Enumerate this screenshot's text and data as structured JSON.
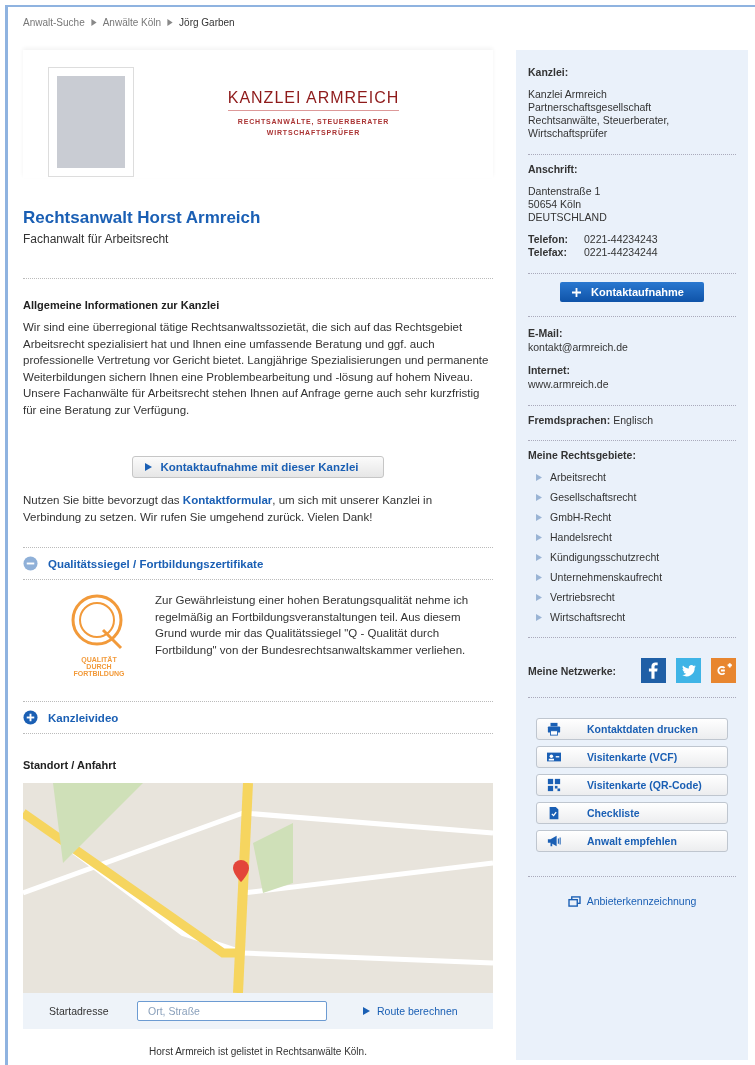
{
  "breadcrumb": [
    {
      "label": "Anwalt-Suche",
      "current": false
    },
    {
      "label": "Anwälte Köln",
      "current": false
    },
    {
      "label": "Jörg Garben",
      "current": true
    }
  ],
  "header": {
    "logo_title": "KANZLEI ARMREICH",
    "logo_line1": "RECHTSANWÄLTE, STEUERBERATER",
    "logo_line2": "WIRTSCHAFTSPRÜFER",
    "name": "Rechtsanwalt Horst Armreich",
    "subtitle": "Fachanwalt für Arbeitsrecht"
  },
  "info": {
    "heading": "Allgemeine Informationen zur Kanzlei",
    "text": "Wir sind eine überregional tätige Rechtsanwaltssozietät, die sich auf das Rechtsgebiet Arbeitsrecht spezialisiert hat und Ihnen eine umfassende Beratung und ggf. auch professionelle Vertretung vor Gericht bietet. Langjährige Spezialisierungen und permanente Weiterbildungen sichern Ihnen eine Problembearbeitung und -lösung auf hohem Niveau. Unsere Fachanwälte für Arbeitsrecht stehen Ihnen auf Anfrage gerne auch sehr kurzfristig für eine Beratung zur Verfügung."
  },
  "contact_button": "Kontaktaufnahme mit dieser Kanzlei",
  "contact_note": {
    "before": "Nutzen Sie bitte bevorzugt das ",
    "link": "Kontaktformular",
    "after": ", um sich mit unserer Kanzlei in Verbindung zu setzen. Wir rufen Sie umgehend zurück. Vielen Dank!"
  },
  "sections": [
    {
      "title": "Qualitätssiegel / Fortbildungszertifikate",
      "expanded": true,
      "badge_text": "QUALITÄT DURCH FORTBILDUNG",
      "text": "Zur Gewährleistung einer hohen Beratungsqualität nehme ich regelmäßig an Fortbildungsveranstaltungen teil. Aus diesem Grund wurde mir das Qualitätssiegel \"Q - Qualität durch Fortbildung\" von der Bundesrechtsanwaltskammer verliehen."
    },
    {
      "title": "Kanzleivideo",
      "expanded": false
    }
  ],
  "location": {
    "heading": "Standort / Anfahrt",
    "start_label": "Startadresse",
    "start_placeholder": "Ort, Straße",
    "route_link": "Route berechnen",
    "footer": "Horst Armreich ist gelistet in Rechtsanwälte Köln."
  },
  "sidebar": {
    "firm_label": "Kanzlei:",
    "firm_lines": [
      "Kanzlei Armreich",
      "Partnerschaftsgesellschaft",
      "Rechtsanwälte, Steuerberater,",
      "Wirtschaftsprüfer"
    ],
    "address_label": "Anschrift:",
    "address_lines": [
      "Dantenstraße 1",
      "50654 Köln",
      "DEUTSCHLAND"
    ],
    "phones": [
      {
        "label": "Telefon:",
        "value": "0221-44234243"
      },
      {
        "label": "Telefax:",
        "value": "0221-44234244"
      }
    ],
    "contact_button": "Kontaktaufnahme",
    "email_label": "E-Mail:",
    "email": "kontakt@armreich.de",
    "internet_label": "Internet:",
    "internet": "www.armreich.de",
    "languages_label": "Fremdsprachen:",
    "languages": "Englisch",
    "areas_label": "Meine Rechtsgebiete:",
    "areas": [
      "Arbeitsrecht",
      "Gesellschaftsrecht",
      "GmbH-Recht",
      "Handelsrecht",
      "Kündigungsschutzrecht",
      "Unternehmenskaufrecht",
      "Vertriebsrecht",
      "Wirtschaftsrecht"
    ],
    "networks_label": "Meine Netzwerke:",
    "networks": [
      {
        "kind": "facebook",
        "color": "#1f5fa6"
      },
      {
        "kind": "twitter",
        "color": "#3fb4e6"
      },
      {
        "kind": "googleplus",
        "color": "#e8862f"
      }
    ],
    "actions": [
      {
        "kind": "print",
        "label": "Kontaktdaten drucken"
      },
      {
        "kind": "vcard",
        "label": "Visitenkarte (VCF)"
      },
      {
        "kind": "qr",
        "label": "Visitenkarte (QR-Code)"
      },
      {
        "kind": "checklist",
        "label": "Checkliste"
      },
      {
        "kind": "recommend",
        "label": "Anwalt empfehlen"
      }
    ],
    "imprint_link": "Anbieterkennzeichnung"
  }
}
